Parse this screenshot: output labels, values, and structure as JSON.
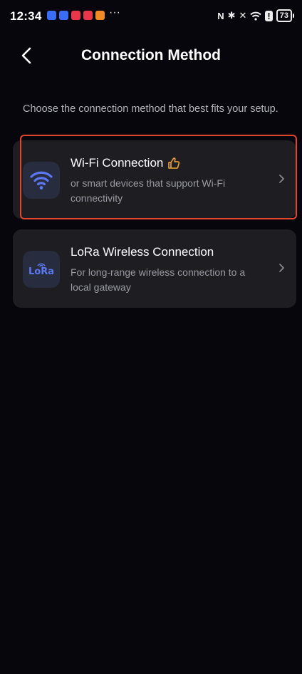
{
  "status_bar": {
    "time": "12:34",
    "notification_overflow": "···",
    "battery": "73",
    "notification_colors": [
      "#3b6cf5",
      "#3b6cf5",
      "#e8364a",
      "#e8364a",
      "#f08a24"
    ]
  },
  "header": {
    "title": "Connection Method",
    "back_icon": "chevron-left-icon"
  },
  "intro_text": "Choose the connection method that best fits your setup.",
  "options": [
    {
      "title": "Wi-Fi Connection",
      "description": "or smart devices that support Wi-Fi connectivity",
      "icon": "wifi-icon",
      "badge_icon": "thumbs-up-icon",
      "highlighted": true
    },
    {
      "title": "LoRa Wireless Connection",
      "description": "For long-range wireless connection to a local gateway",
      "icon": "lora-icon",
      "icon_text": "LoRa",
      "highlighted": false
    }
  ],
  "colors": {
    "background": "#06060c",
    "card": "#1d1d22",
    "accent": "#5b78f0",
    "highlight_border": "#e2452c",
    "badge": "#f2a33a"
  }
}
